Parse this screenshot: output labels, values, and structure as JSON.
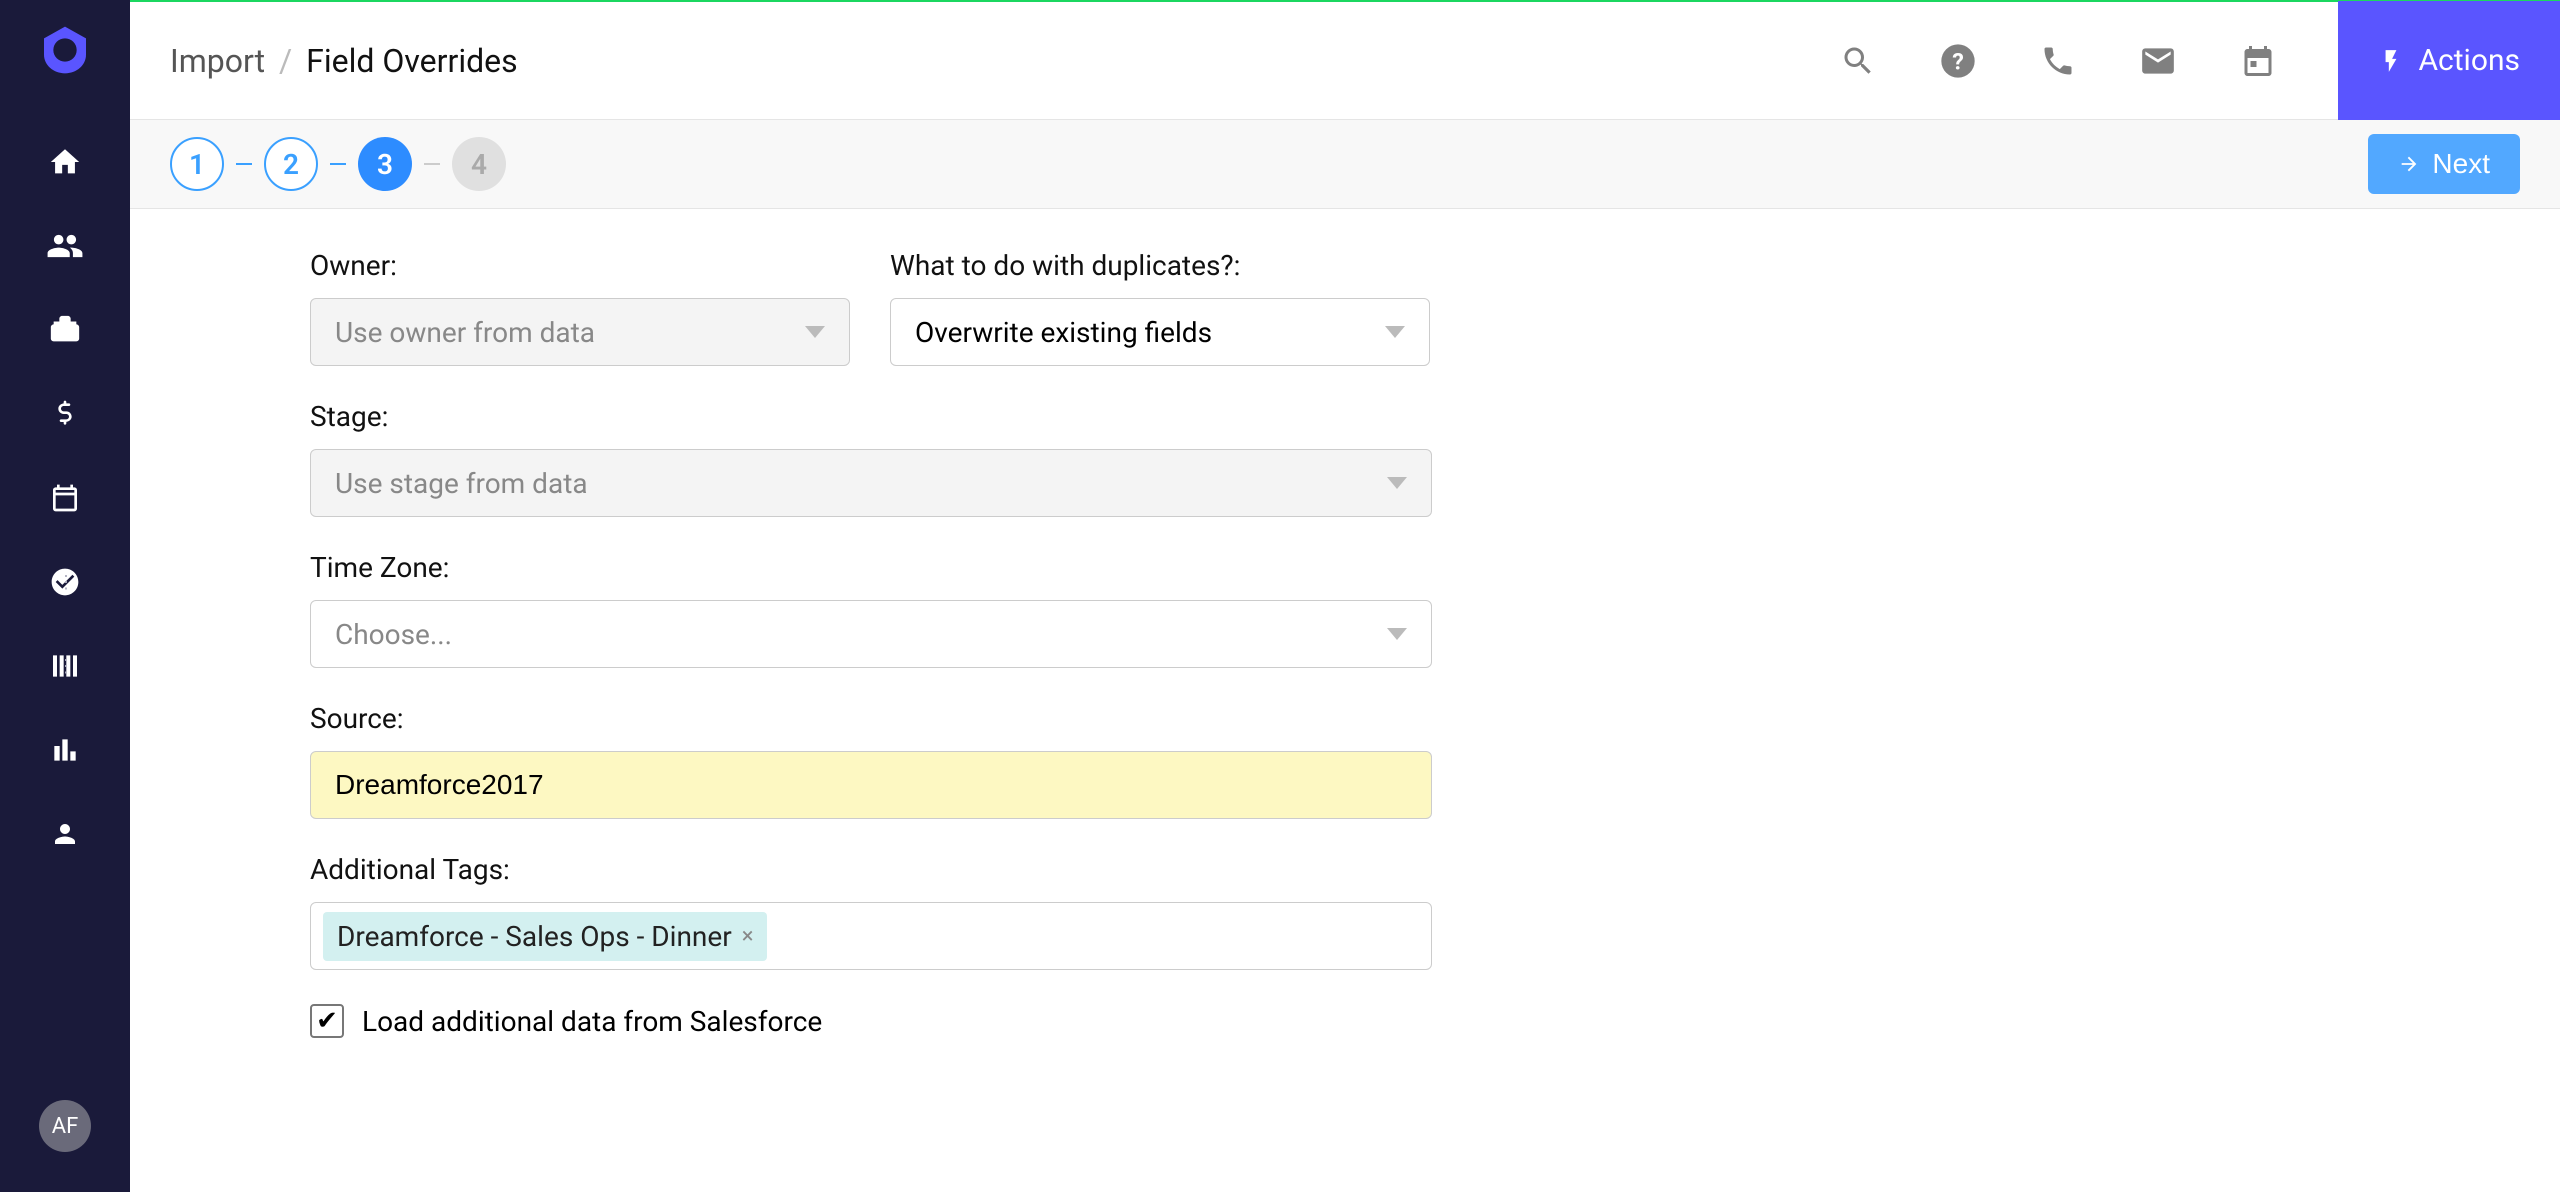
{
  "breadcrumb": {
    "parent": "Import",
    "current": "Field Overrides"
  },
  "actions_button": "Actions",
  "next_button": "Next",
  "steps": {
    "s1": "1",
    "s2": "2",
    "s3": "3",
    "s4": "4"
  },
  "form": {
    "owner_label": "Owner:",
    "owner_placeholder": "Use owner from data",
    "duplicates_label": "What to do with duplicates?:",
    "duplicates_value": "Overwrite existing fields",
    "stage_label": "Stage:",
    "stage_placeholder": "Use stage from data",
    "timezone_label": "Time Zone:",
    "timezone_placeholder": "Choose...",
    "source_label": "Source:",
    "source_value": "Dreamforce2017",
    "tags_label": "Additional Tags:",
    "tag_1": "Dreamforce - Sales Ops - Dinner",
    "checkbox_label": "Load additional data from Salesforce"
  },
  "avatar": "AF"
}
